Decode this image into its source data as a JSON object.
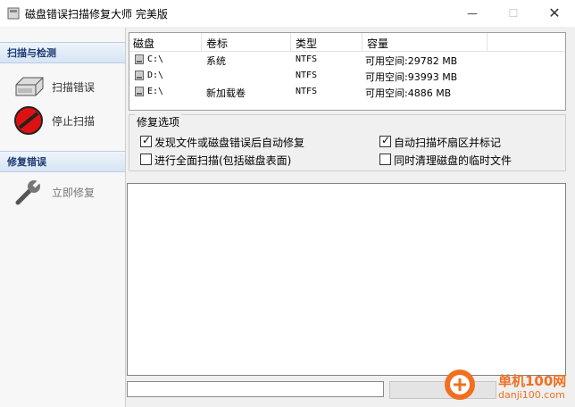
{
  "window": {
    "title": "磁盘错误扫描修复大师 完美版",
    "minimize": "—",
    "maximize": "☐",
    "close": "✕"
  },
  "sidebar": {
    "scan_section": "扫描与检测",
    "scan_errors": "扫描错误",
    "stop_scan": "停止扫描",
    "repair_section": "修复错误",
    "repair_now": "立即修复"
  },
  "drives": {
    "columns": [
      "磁盘",
      "卷标",
      "类型",
      "容量"
    ],
    "rows": [
      {
        "disk": "C:\\",
        "label": "系统",
        "type": "NTFS",
        "capacity": "可用空间:29782 MB"
      },
      {
        "disk": "D:\\",
        "label": "",
        "type": "NTFS",
        "capacity": "可用空间:93993 MB"
      },
      {
        "disk": "E:\\",
        "label": "新加载卷",
        "type": "NTFS",
        "capacity": "可用空间:4886 MB"
      }
    ]
  },
  "options": {
    "legend": "修复选项",
    "auto_repair": {
      "label": "发现文件或磁盘错误后自动修复",
      "checked": true
    },
    "full_scan": {
      "label": "进行全面扫描(包括磁盘表面)",
      "checked": false
    },
    "mark_bad": {
      "label": "自动扫描坏扇区并标记",
      "checked": true
    },
    "clean_temp": {
      "label": "同时清理磁盘的临时文件",
      "checked": false
    }
  },
  "watermark": {
    "brand": "单机100网",
    "url": "danji100.com"
  }
}
